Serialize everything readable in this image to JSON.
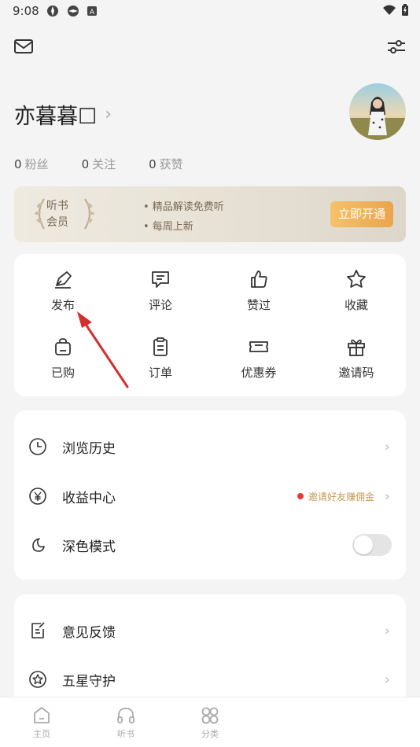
{
  "status_bar": {
    "time": "9:08"
  },
  "profile": {
    "name": "亦暮暮☐",
    "chevron": "›"
  },
  "stats": [
    {
      "count": "0",
      "label": "粉丝"
    },
    {
      "count": "0",
      "label": "关注"
    },
    {
      "count": "0",
      "label": "获赞"
    }
  ],
  "vip_banner": {
    "badge_line1": "听书",
    "badge_line2": "会员",
    "benefit1": "• 精品解读免费听",
    "benefit2": "• 每周上新",
    "cta": "立即开通"
  },
  "grid": [
    {
      "label": "发布",
      "icon": "pen-nib-icon"
    },
    {
      "label": "评论",
      "icon": "comment-icon"
    },
    {
      "label": "赞过",
      "icon": "thumbs-up-icon"
    },
    {
      "label": "收藏",
      "icon": "star-icon"
    },
    {
      "label": "已购",
      "icon": "shopping-bag-icon"
    },
    {
      "label": "订单",
      "icon": "clipboard-icon"
    },
    {
      "label": "优惠券",
      "icon": "ticket-icon"
    },
    {
      "label": "邀请码",
      "icon": "gift-icon"
    }
  ],
  "list1": {
    "history": "浏览历史",
    "earnings": "收益中心",
    "earnings_promo": "邀请好友赚佣金",
    "dark_mode": "深色模式",
    "dark_mode_on": false
  },
  "list2": {
    "feedback": "意见反馈",
    "five_star": "五星守护"
  },
  "chevron": "›",
  "tabs": [
    {
      "label": "主页",
      "icon": "home-icon"
    },
    {
      "label": "听书",
      "icon": "headphones-icon"
    },
    {
      "label": "分类",
      "icon": "category-icon"
    }
  ],
  "colors": {
    "accent_gold": "#eba44d",
    "promo_text": "#c59a52",
    "annotation_arrow": "#d32f2f"
  }
}
